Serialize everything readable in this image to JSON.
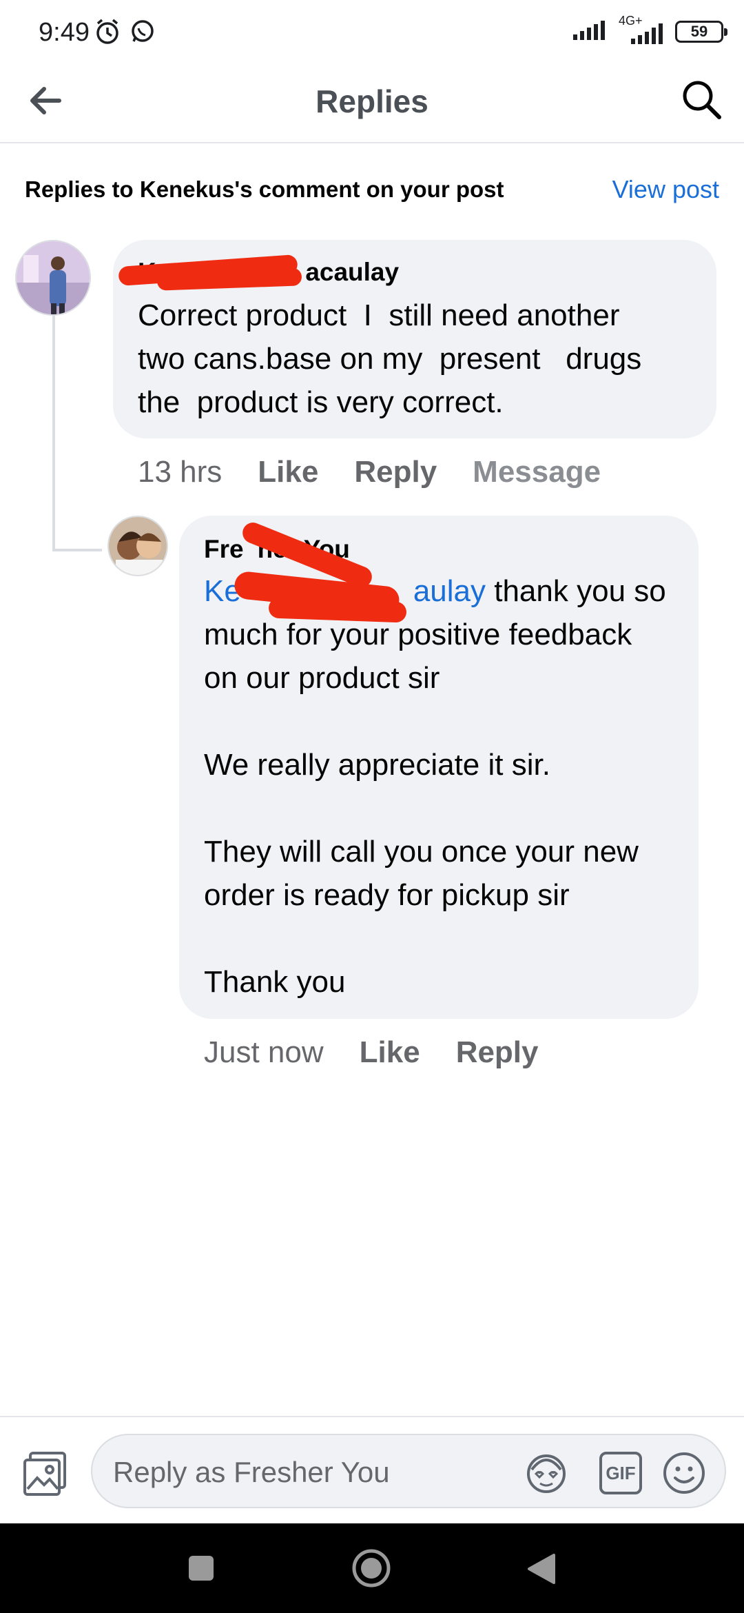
{
  "status_bar": {
    "time": "9:49",
    "network": "4G+",
    "battery": "59"
  },
  "header": {
    "title": "Replies"
  },
  "subheader": {
    "label": "Replies to Kenekus's comment on your post",
    "view_post": "View post"
  },
  "comment": {
    "author_visible": "Ke…acaulay",
    "author_prefix": "Ke",
    "author_suffix": "acaulay",
    "text": "Correct product  I  still need another\ntwo cans.base on my  present   drugs\nthe  product is very correct.",
    "time": "13 hrs",
    "like": "Like",
    "reply": "Reply",
    "message": "Message"
  },
  "reply": {
    "author_prefix": "Fre",
    "author_suffix": "her You",
    "mention_prefix": "Ke",
    "mention_suffix": "aulay",
    "text_line1": " thank you so",
    "text_rest": "much for your positive feedback\non our product sir\n\nWe really appreciate it sir.\n\nThey will call you once your new\norder is ready for pickup sir\n\nThank you",
    "time": "Just now",
    "like": "Like",
    "reply": "Reply"
  },
  "composer": {
    "placeholder": "Reply as Fresher You",
    "gif": "GIF"
  },
  "colors": {
    "accent": "#1a6ed8",
    "bubble": "#f0f2f5",
    "redaction": "#ef2c12"
  }
}
